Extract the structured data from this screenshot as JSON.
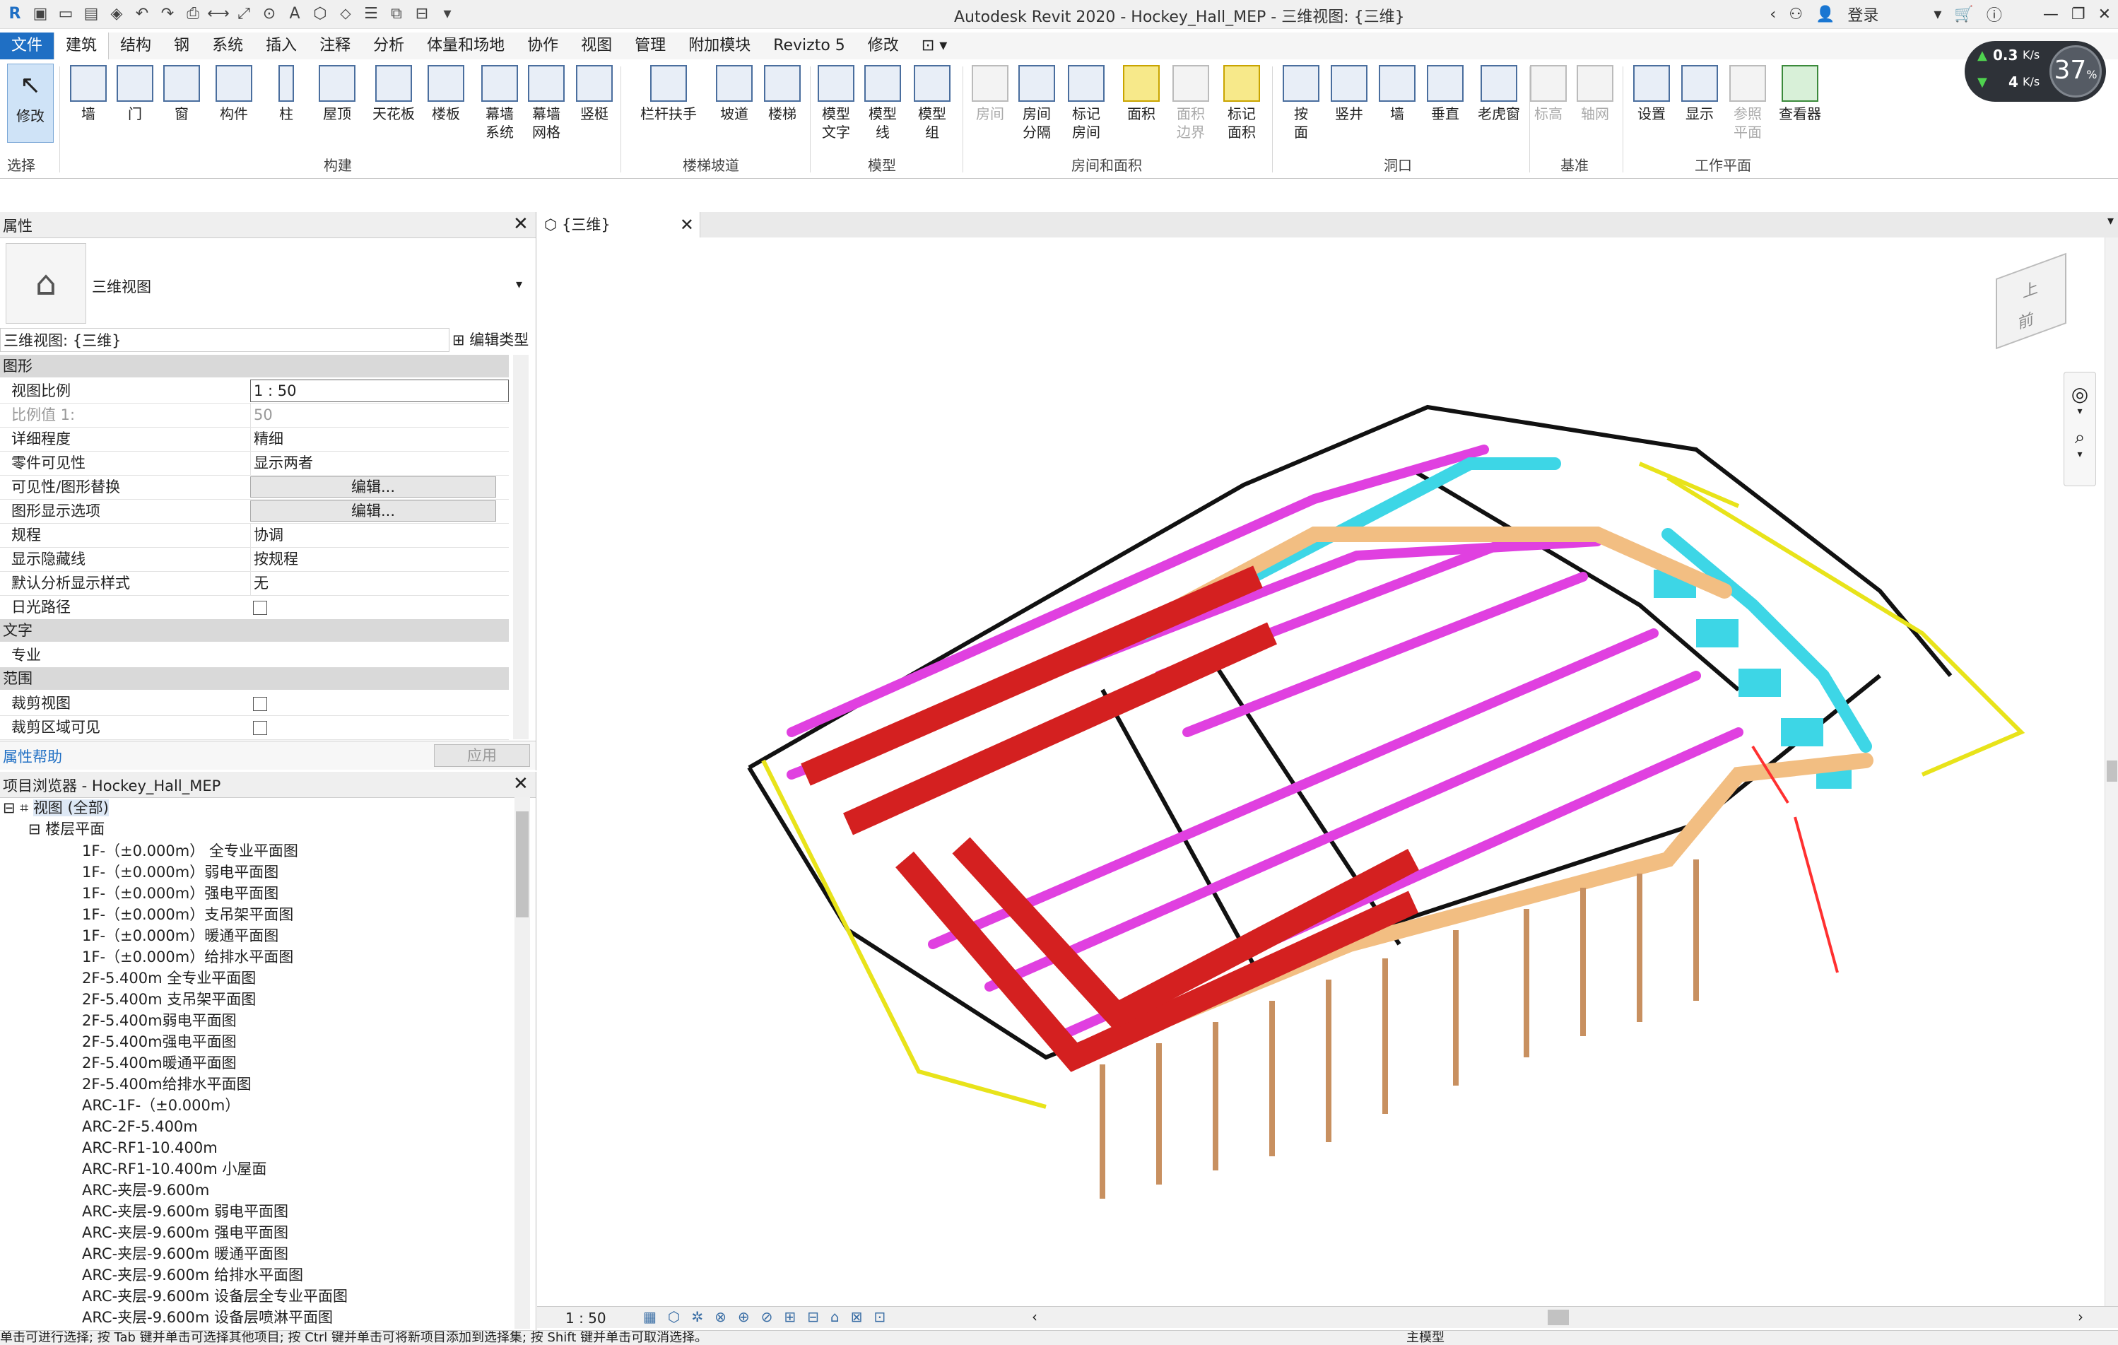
{
  "title": "Autodesk Revit 2020 - Hockey_Hall_MEP - 三维视图: {三维}",
  "account": {
    "login": "登录"
  },
  "tabs": [
    "文件",
    "建筑",
    "结构",
    "钢",
    "系统",
    "插入",
    "注释",
    "分析",
    "体量和场地",
    "协作",
    "视图",
    "管理",
    "附加模块",
    "Revizto 5",
    "修改"
  ],
  "ribbon": {
    "modify": "修改",
    "select": "选择",
    "build": [
      "墙",
      "门",
      "窗",
      "构件",
      "柱",
      "屋顶",
      "天花板",
      "楼板",
      "幕墙\n系统",
      "幕墙\n网格",
      "竖梃"
    ],
    "build_label": "构建",
    "stairs": [
      "栏杆扶手",
      "坡道",
      "楼梯"
    ],
    "stairs_label": "楼梯坡道",
    "model": [
      "模型\n文字",
      "模型\n线",
      "模型\n组"
    ],
    "model_label": "模型",
    "room": [
      "房间",
      "房间\n分隔",
      "标记\n房间",
      "面积",
      "面积\n边界",
      "标记\n面积"
    ],
    "room_label": "房间和面积",
    "opening": [
      "按\n面",
      "竖井",
      "墙",
      "垂直",
      "老虎窗"
    ],
    "opening_label": "洞口",
    "datum": [
      "标高",
      "轴网"
    ],
    "datum_label": "基准",
    "workplane": [
      "设置",
      "显示",
      "参照\n平面",
      "查看器"
    ],
    "workplane_label": "工作平面"
  },
  "network": {
    "up": "0.3",
    "up_unit": "K/s",
    "down": "4",
    "down_unit": "K/s",
    "cpu": "37",
    "cpu_unit": "%"
  },
  "properties": {
    "panel_title": "属性",
    "type_name": "三维视图",
    "instance": "三维视图: {三维}",
    "edit_type": "编辑类型",
    "cat_graphics": "图形",
    "rows": [
      {
        "k": "视图比例",
        "v": "1 : 50"
      },
      {
        "k": "比例值 1:",
        "v": "50"
      },
      {
        "k": "详细程度",
        "v": "精细"
      },
      {
        "k": "零件可见性",
        "v": "显示两者"
      },
      {
        "k": "可见性/图形替换",
        "v": "编辑..."
      },
      {
        "k": "图形显示选项",
        "v": "编辑..."
      },
      {
        "k": "规程",
        "v": "协调"
      },
      {
        "k": "显示隐藏线",
        "v": "按规程"
      },
      {
        "k": "默认分析显示样式",
        "v": "无"
      },
      {
        "k": "日光路径",
        "v": ""
      }
    ],
    "cat_text": "文字",
    "row_discipline": "专业",
    "cat_extent": "范围",
    "row_crop": "裁剪视图",
    "row_crop_visible": "裁剪区域可见",
    "help": "属性帮助",
    "apply": "应用"
  },
  "browser": {
    "title": "项目浏览器 - Hockey_Hall_MEP",
    "root": "视图 (全部)",
    "floor_plans": "楼层平面",
    "items": [
      "1F-（±0.000m） 全专业平面图",
      "1F-（±0.000m）弱电平面图",
      "1F-（±0.000m）强电平面图",
      "1F-（±0.000m）支吊架平面图",
      "1F-（±0.000m）暖通平面图",
      "1F-（±0.000m）给排水平面图",
      "2F-5.400m 全专业平面图",
      "2F-5.400m 支吊架平面图",
      "2F-5.400m弱电平面图",
      "2F-5.400m强电平面图",
      "2F-5.400m暖通平面图",
      "2F-5.400m给排水平面图",
      "ARC-1F-（±0.000m）",
      "ARC-2F-5.400m",
      "ARC-RF1-10.400m",
      "ARC-RF1-10.400m 小屋面",
      "ARC-夹层-9.600m",
      "ARC-夹层-9.600m 弱电平面图",
      "ARC-夹层-9.600m 强电平面图",
      "ARC-夹层-9.600m 暖通平面图",
      "ARC-夹层-9.600m 给排水平面图",
      "ARC-夹层-9.600m 设备层全专业平面图",
      "ARC-夹层-9.600m 设备层喷淋平面图"
    ]
  },
  "view": {
    "tab": "{三维}",
    "viewcube_top": "上",
    "viewcube_front": "前",
    "scale": "1 : 50"
  },
  "status": {
    "hint": "单击可进行选择; 按 Tab 键并单击可选择其他项目; 按 Ctrl 键并单击可将新项目添加到选择集; 按 Shift 键并单击可取消选择。",
    "model": "主模型"
  }
}
